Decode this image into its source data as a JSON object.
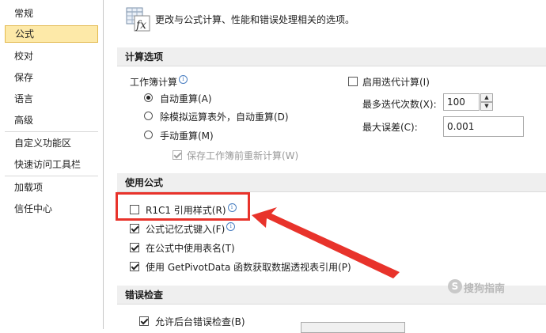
{
  "sidebar": {
    "items": [
      {
        "label": "常规"
      },
      {
        "label": "公式",
        "active": true
      },
      {
        "label": "校对"
      },
      {
        "label": "保存"
      },
      {
        "label": "语言"
      },
      {
        "label": "高级"
      },
      {
        "label": "自定义功能区"
      },
      {
        "label": "快速访问工具栏"
      },
      {
        "label": "加载项"
      },
      {
        "label": "信任中心"
      }
    ]
  },
  "header": {
    "description": "更改与公式计算、性能和错误处理相关的选项。",
    "icon": "formula-fx-icon"
  },
  "sections": {
    "calc": "计算选项",
    "formulas": "使用公式",
    "errors": "错误检查"
  },
  "calc": {
    "workbook_label": "工作簿计算",
    "radio_auto": "自动重算(A)",
    "radio_auto_except": "除模拟运算表外，自动重算(D)",
    "radio_manual": "手动重算(M)",
    "recalc_before_save": "保存工作簿前重新计算(W)",
    "iterative_label": "启用迭代计算(I)",
    "max_iter_label": "最多迭代次数(X):",
    "max_iter_value": "100",
    "max_change_label": "最大误差(C):",
    "max_change_value": "0.001",
    "selected_mode": "auto"
  },
  "formulas": {
    "r1c1_label": "R1C1 引用样式(R)",
    "r1c1_checked": false,
    "autocomplete_label": "公式记忆式键入(F)",
    "autocomplete_checked": true,
    "table_names_label": "在公式中使用表名(T)",
    "table_names_checked": true,
    "getpivot_label": "使用 GetPivotData 函数获取数据透视表引用(P)",
    "getpivot_checked": true
  },
  "errors": {
    "background_label": "允许后台错误检查(B)",
    "background_checked": true
  },
  "watermark": {
    "glyph": "S",
    "text": "搜狗指南"
  },
  "colors": {
    "active_nav_bg": "#fde9a8",
    "highlight": "#e8332b",
    "section_bg": "#efefef"
  }
}
